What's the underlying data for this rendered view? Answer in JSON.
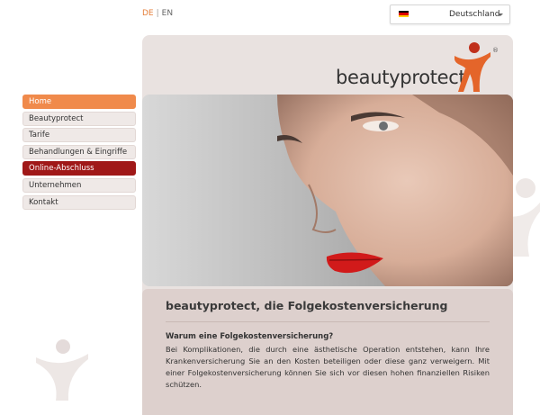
{
  "language": {
    "active": "DE",
    "separator": "|",
    "other": "EN"
  },
  "country_select": {
    "selected": "Deutschland",
    "flag_icon": "germany-flag-icon",
    "flag_colors": [
      "#000000",
      "#dd0000",
      "#ffce00"
    ]
  },
  "brand": {
    "name": "beautyprotect",
    "registered": "®",
    "figure_color": "#e4652a",
    "head_color": "#c0301c"
  },
  "nav": {
    "items": [
      {
        "label": "Home",
        "state": "active"
      },
      {
        "label": "Beautyprotect"
      },
      {
        "label": "Tarife"
      },
      {
        "label": "Behandlungen & Eingriffe"
      },
      {
        "label": "Online-Abschluss",
        "state": "highlight"
      },
      {
        "label": "Unternehmen"
      },
      {
        "label": "Kontakt"
      }
    ]
  },
  "content": {
    "title": "beautyprotect, die Folgekostenversicherung",
    "question": "Warum eine Folgekostenversicherung?",
    "body": "Bei Komplikationen, die durch eine ästhetische Operation entstehen, kann Ihre Krankenversicherung Sie an den Kosten beteiligen oder diese ganz verweigern. Mit einer Folgekostenversicherung können Sie sich vor diesen hohen finanziellen Risiken schützen."
  },
  "colors": {
    "accent": "#f08a4b",
    "highlight": "#a01818",
    "panel": "#e9e2e0"
  }
}
